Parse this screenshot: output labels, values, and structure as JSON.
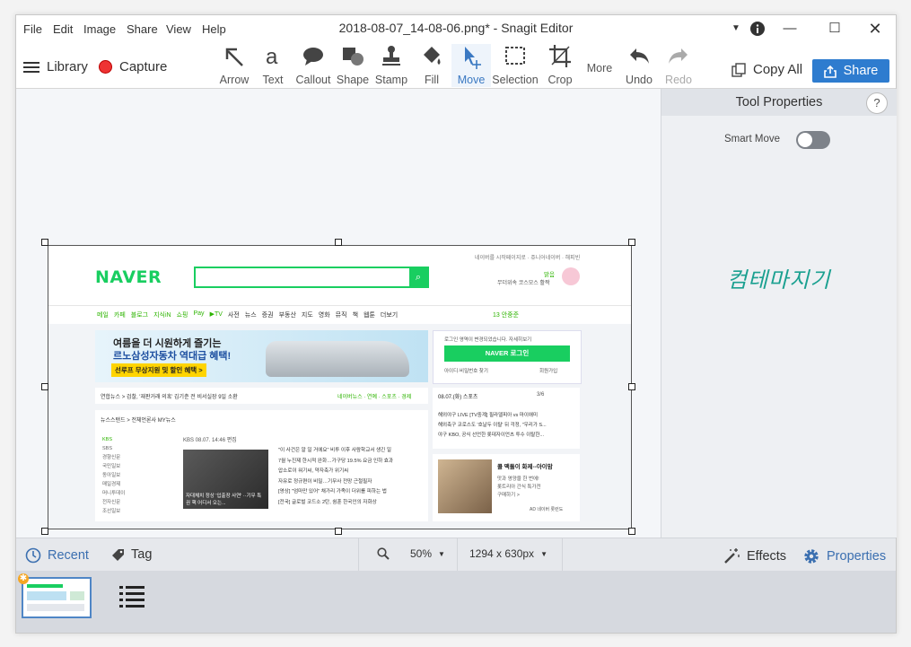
{
  "titlebar": {
    "menus": [
      "File",
      "Edit",
      "Image",
      "Share",
      "View",
      "Help"
    ],
    "title": "2018-08-07_14-08-06.png* - Snagit Editor"
  },
  "toolbar": {
    "library_label": "Library",
    "capture_label": "Capture",
    "tools": [
      {
        "label": "Arrow",
        "icon": "arrow-icon"
      },
      {
        "label": "Text",
        "icon": "text-icon"
      },
      {
        "label": "Callout",
        "icon": "callout-icon"
      },
      {
        "label": "Shape",
        "icon": "shape-icon"
      },
      {
        "label": "Stamp",
        "icon": "stamp-icon"
      },
      {
        "label": "Fill",
        "icon": "fill-icon"
      },
      {
        "label": "Move",
        "icon": "move-icon",
        "selected": true
      },
      {
        "label": "Selection",
        "icon": "selection-icon"
      },
      {
        "label": "Crop",
        "icon": "crop-icon"
      }
    ],
    "more_label": "More",
    "undo_label": "Undo",
    "redo_label": "Redo",
    "copy_all_label": "Copy All",
    "share_label": "Share",
    "accent_color": "#2e7ccf"
  },
  "panel": {
    "title": "Tool Properties",
    "help": "?",
    "smart_move_label": "Smart Move",
    "smart_move_on": false
  },
  "canvas": {
    "handwriting": "컴테마지기",
    "naver": {
      "top_links": "네이버를 시작페이지로 ·  쥬니어네이버 · 해피빈",
      "logo": "NAVER",
      "weather_top": "맑음",
      "weather_sub": "무더위속 코스모스 활짝",
      "nav": [
        "메일",
        "카페",
        "블로그",
        "지식iN",
        "쇼핑",
        "Pay",
        "▶TV",
        "사전",
        "뉴스",
        "증권",
        "부동산",
        "지도",
        "영화",
        "뮤직",
        "책",
        "웹툰",
        "더보기"
      ],
      "realtime": "13 안중준",
      "banner_line1": "여름을 더 시원하게 즐기는",
      "banner_line2": "르노삼성자동차 역대급 혜택!",
      "banner_cta": "선루프 무상지원 및 할인 혜택 >",
      "login_notice": "로그인 영역이 변경되었습니다. 자세히보기",
      "login_btn": "NAVER 로그인",
      "login_find": "아이디·비밀번호 찾기",
      "login_join": "회원가입",
      "news_strip": "연합뉴스 >  검찰, '재판거래 의혹' 김기춘 전 비서실장 9일 소환",
      "news_tabs": "네이버뉴스 · 연예 · 스포츠 · 경제",
      "news_stand": "뉴스스탠드 >  전체언론사   MY뉴스",
      "press_list": [
        "KBS",
        "SBS",
        "경향신문",
        "국민일보",
        "동아일보",
        "매일경제",
        "머니투데이",
        "전자신문",
        "조선일보"
      ],
      "headline_src": "KBS  08.07. 14:46 편집",
      "headlines": [
        "\"이 사건은 알 일 거에요\" 비투 이후 사람학교서 생긴 일",
        "7월 누진제 한시적 완화…가구당 19.5% 요금 인하 효과",
        "압소로이 워기씨, 약자축가 위기씨",
        "자유로 정규편이 비밀…기무사 전망 근절필자",
        "[영상] \"엄마만 있어\" 채가리 가족이 더위를 피하는 법",
        "[전국] 글로벌 코드소 2탄, 쉼훈 한국인의 자화상"
      ],
      "photo_caption": "자대체치 정상 '입출장 사연' ··기무 특권 핵 어디서 오는...",
      "sport_date": "08.07.(화)  스포츠",
      "sport_page": "3/6",
      "sport_items": [
        "해외야구  LIVE [TV중계] 필라델피아 vs 마이애미",
        "해외축구  코로스도 '호날두 이탈' 뒤 걱정, \"우리가 S...",
        "야구  KBO, 공식 선언한 롯데자이언츠 투수 이탈한..."
      ],
      "ad_title": "콜 맥돌이 화제--아이맘",
      "ad_lines": [
        "맛과 영양을 한 번에!",
        "롯트리아 간식 특가전",
        "구매하기 >"
      ],
      "ad_tag": "AD  네이버 롯런도"
    }
  },
  "bottombar": {
    "recent_label": "Recent",
    "tag_label": "Tag",
    "zoom": "50%",
    "dimensions": "1294 x 630px",
    "effects_label": "Effects",
    "properties_label": "Properties"
  }
}
